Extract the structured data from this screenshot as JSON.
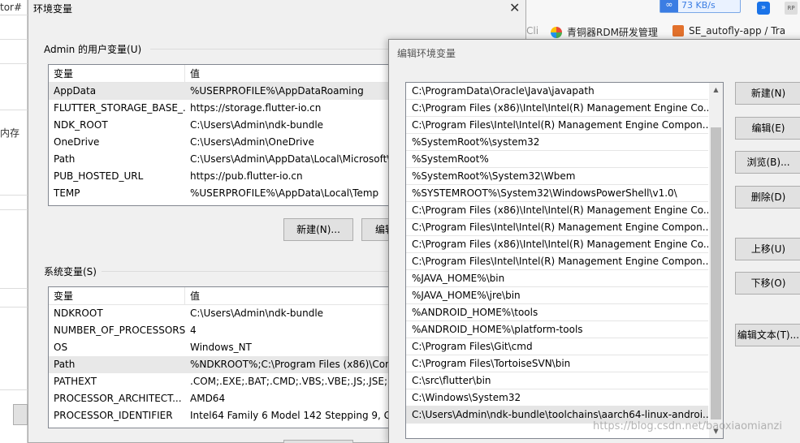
{
  "background": {
    "left_fragment_1": "tor#",
    "left_fragment_2": "内存",
    "speed": "73 KB/s",
    "speed_icon": "∞",
    "ext1_icon": "»",
    "ext2_label": "RP",
    "bookmarks": [
      {
        "label": "Cli",
        "icon_color": "#999999"
      },
      {
        "label": "青铜器RDM研发管理",
        "icon_color": "#e84b3c"
      },
      {
        "label": "SE_autofly-app / Tra",
        "icon_color": "#e2712c"
      }
    ]
  },
  "env_dialog": {
    "title": "环境变量",
    "close_icon": "✕",
    "user_vars": {
      "label": "Admin 的用户变量(U)",
      "col_var": "变量",
      "col_val": "值",
      "rows": [
        {
          "name": "AppData",
          "value": "%USERPROFILE%\\AppDataRoaming"
        },
        {
          "name": "FLUTTER_STORAGE_BASE_...",
          "value": "https://storage.flutter-io.cn"
        },
        {
          "name": "NDK_ROOT",
          "value": "C:\\Users\\Admin\\ndk-bundle"
        },
        {
          "name": "OneDrive",
          "value": "C:\\Users\\Admin\\OneDrive"
        },
        {
          "name": "Path",
          "value": "C:\\Users\\Admin\\AppData\\Local\\Microsoft\\"
        },
        {
          "name": "PUB_HOSTED_URL",
          "value": "https://pub.flutter-io.cn"
        },
        {
          "name": "TEMP",
          "value": "%USERPROFILE%\\AppData\\Local\\Temp"
        }
      ],
      "new_button": "新建(N)...",
      "edit_button": "编辑"
    },
    "system_vars": {
      "label": "系统变量(S)",
      "col_var": "变量",
      "col_val": "值",
      "rows": [
        {
          "name": "NDKROOT",
          "value": "C:\\Users\\Admin\\ndk-bundle"
        },
        {
          "name": "NUMBER_OF_PROCESSORS",
          "value": "4"
        },
        {
          "name": "OS",
          "value": "Windows_NT"
        },
        {
          "name": "Path",
          "value": "%NDKROOT%;C:\\Program Files (x86)\\Com"
        },
        {
          "name": "PATHEXT",
          "value": ".COM;.EXE;.BAT;.CMD;.VBS;.VBE;.JS;.JSE;.WS"
        },
        {
          "name": "PROCESSOR_ARCHITECT...",
          "value": "AMD64"
        },
        {
          "name": "PROCESSOR_IDENTIFIER",
          "value": "Intel64 Family 6 Model 142 Stepping 9, Ge"
        }
      ]
    }
  },
  "edit_dialog": {
    "title": "编辑环境变量",
    "paths": [
      "C:\\ProgramData\\Oracle\\Java\\javapath",
      "C:\\Program Files (x86)\\Intel\\Intel(R) Management Engine Co...",
      "C:\\Program Files\\Intel\\Intel(R) Management Engine Compon...",
      "%SystemRoot%\\system32",
      "%SystemRoot%",
      "%SystemRoot%\\System32\\Wbem",
      "%SYSTEMROOT%\\System32\\WindowsPowerShell\\v1.0\\",
      "C:\\Program Files (x86)\\Intel\\Intel(R) Management Engine Co...",
      "C:\\Program Files\\Intel\\Intel(R) Management Engine Compon...",
      "C:\\Program Files (x86)\\Intel\\Intel(R) Management Engine Co...",
      "C:\\Program Files\\Intel\\Intel(R) Management Engine Compon...",
      "%JAVA_HOME%\\bin",
      "%JAVA_HOME%\\jre\\bin",
      "%ANDROID_HOME%\\tools",
      "%ANDROID_HOME%\\platform-tools",
      "C:\\Program Files\\Git\\cmd",
      "C:\\Program Files\\TortoiseSVN\\bin",
      "C:\\src\\flutter\\bin",
      "C:\\Windows\\System32",
      "C:\\Users\\Admin\\ndk-bundle\\toolchains\\aarch64-linux-androi..."
    ],
    "buttons": {
      "new": "新建(N)",
      "edit": "编辑(E)",
      "browse": "浏览(B)...",
      "delete": "删除(D)",
      "up": "上移(U)",
      "down": "下移(O)",
      "edit_text": "编辑文本(T)..."
    },
    "scroll_up_icon": "▲",
    "scroll_down_icon": "▼"
  },
  "watermark": "https://blog.csdn.net/baoxiaomianzi"
}
